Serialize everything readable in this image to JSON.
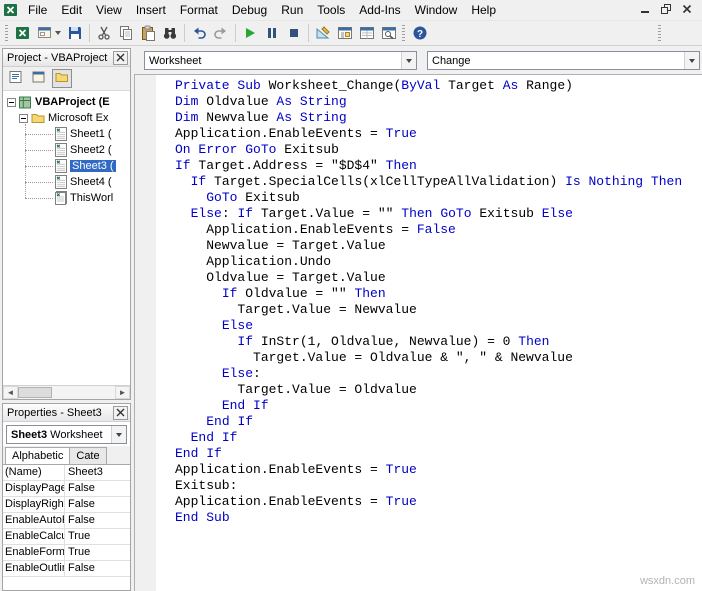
{
  "colors": {
    "keyword": "#0000C8",
    "selection": "#316AC5"
  },
  "menu": {
    "items": [
      "File",
      "Edit",
      "View",
      "Insert",
      "Format",
      "Debug",
      "Run",
      "Tools",
      "Add-Ins",
      "Window",
      "Help"
    ]
  },
  "window_controls": [
    "minimize",
    "restore",
    "close"
  ],
  "toolbar": {
    "items": [
      {
        "grip": true
      },
      {
        "icon": "excel"
      },
      {
        "icon": "insert-userform",
        "caret": true
      },
      {
        "icon": "save"
      },
      {
        "sep": true
      },
      {
        "icon": "cut"
      },
      {
        "icon": "copy"
      },
      {
        "icon": "paste"
      },
      {
        "icon": "find"
      },
      {
        "sep": true
      },
      {
        "icon": "undo"
      },
      {
        "icon": "redo"
      },
      {
        "sep": true
      },
      {
        "icon": "run"
      },
      {
        "icon": "break"
      },
      {
        "icon": "reset"
      },
      {
        "sep": true
      },
      {
        "icon": "design-mode"
      },
      {
        "icon": "project-explorer"
      },
      {
        "icon": "properties-window"
      },
      {
        "icon": "object-browser"
      },
      {
        "grip": true
      },
      {
        "icon": "help"
      },
      {
        "grip": true,
        "right": true
      }
    ]
  },
  "project_panel": {
    "title": "Project - VBAProject",
    "toolbar": [
      {
        "icon": "view-code"
      },
      {
        "icon": "view-object"
      },
      {
        "icon": "toggle-folders",
        "pressed": true
      }
    ],
    "root_label": "VBAProject (E",
    "folder_label": "Microsoft Ex",
    "sheets": [
      {
        "label": "Sheet1 ("
      },
      {
        "label": "Sheet2 ("
      },
      {
        "label": "Sheet3 (",
        "selected": true
      },
      {
        "label": "Sheet4 ("
      },
      {
        "label": "ThisWorl",
        "icon": "workbook"
      }
    ]
  },
  "properties_panel": {
    "title": "Properties - Sheet3",
    "selector_name": "Sheet3",
    "selector_type": "Worksheet",
    "tabs": [
      "Alphabetic",
      "Cate"
    ],
    "rows": [
      [
        "(Name)",
        "Sheet3"
      ],
      [
        "DisplayPage",
        "False"
      ],
      [
        "DisplayRight",
        "False"
      ],
      [
        "EnableAutoF",
        "False"
      ],
      [
        "EnableCalcu",
        "True"
      ],
      [
        "EnableForm",
        "True"
      ],
      [
        "EnableOutlin",
        "False"
      ]
    ]
  },
  "code_pane": {
    "object_dropdown": "Worksheet",
    "procedure_dropdown": "Change",
    "watermark": "wsxdn.com",
    "lines": [
      "Private Sub Worksheet_Change(ByVal Target As Range)",
      "Dim Oldvalue As String",
      "Dim Newvalue As String",
      "Application.EnableEvents = True",
      "On Error GoTo Exitsub",
      "If Target.Address = \"$D$4\" Then",
      "  If Target.SpecialCells(xlCellTypeAllValidation) Is Nothing Then",
      "    GoTo Exitsub",
      "  Else: If Target.Value = \"\" Then GoTo Exitsub Else",
      "    Application.EnableEvents = False",
      "    Newvalue = Target.Value",
      "    Application.Undo",
      "    Oldvalue = Target.Value",
      "      If Oldvalue = \"\" Then",
      "        Target.Value = Newvalue",
      "      Else",
      "        If InStr(1, Oldvalue, Newvalue) = 0 Then",
      "          Target.Value = Oldvalue & \", \" & Newvalue",
      "      Else:",
      "        Target.Value = Oldvalue",
      "      End If",
      "    End If",
      "  End If",
      "End If",
      "Application.EnableEvents = True",
      "Exitsub:",
      "Application.EnableEvents = True",
      "End Sub"
    ]
  }
}
